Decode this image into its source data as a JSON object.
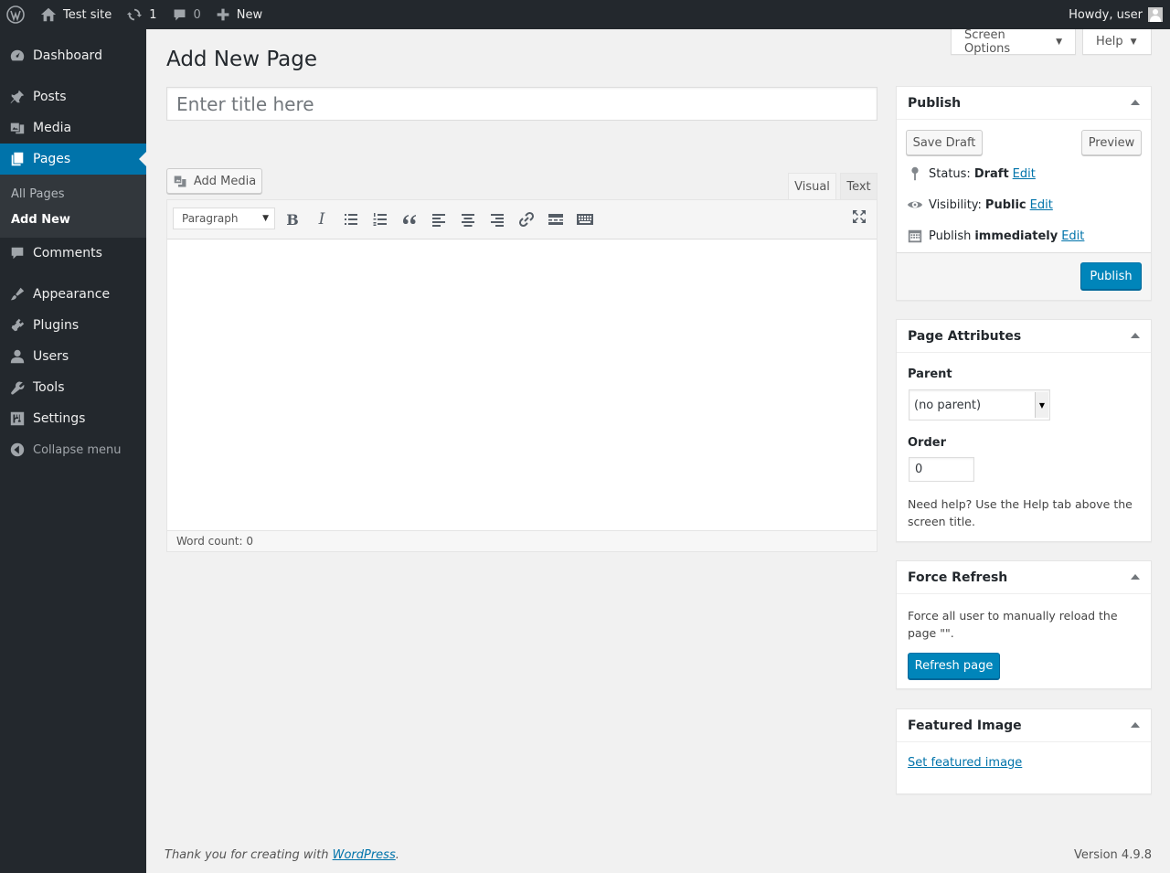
{
  "adminbar": {
    "site_name": "Test site",
    "updates_count": "1",
    "comments_count": "0",
    "new_label": "New",
    "howdy": "Howdy, user"
  },
  "sidebar": {
    "items": [
      {
        "label": "Dashboard",
        "icon": "dashboard-icon"
      },
      {
        "label": "Posts",
        "icon": "pin-icon"
      },
      {
        "label": "Media",
        "icon": "media-icon"
      },
      {
        "label": "Pages",
        "icon": "pages-icon"
      },
      {
        "label": "Comments",
        "icon": "comment-icon"
      },
      {
        "label": "Appearance",
        "icon": "brush-icon"
      },
      {
        "label": "Plugins",
        "icon": "plug-icon"
      },
      {
        "label": "Users",
        "icon": "user-icon"
      },
      {
        "label": "Tools",
        "icon": "wrench-icon"
      },
      {
        "label": "Settings",
        "icon": "settings-icon"
      }
    ],
    "submenu": [
      "All Pages",
      "Add New"
    ],
    "collapse_label": "Collapse menu"
  },
  "header": {
    "title": "Add New Page",
    "screen_options": "Screen Options",
    "help": "Help"
  },
  "editor": {
    "title_placeholder": "Enter title here",
    "add_media": "Add Media",
    "tab_visual": "Visual",
    "tab_text": "Text",
    "format_value": "Paragraph",
    "bold": "B",
    "italic": "I",
    "word_count": "Word count: 0"
  },
  "publish": {
    "title": "Publish",
    "save_draft": "Save Draft",
    "preview": "Preview",
    "status_label": "Status:",
    "status_value": "Draft",
    "visibility_label": "Visibility:",
    "visibility_value": "Public",
    "publish_label": "Publish",
    "publish_value": "immediately",
    "edit": "Edit",
    "publish_button": "Publish"
  },
  "page_attributes": {
    "title": "Page Attributes",
    "parent_label": "Parent",
    "parent_value": "(no parent)",
    "order_label": "Order",
    "order_value": "0",
    "help": "Need help? Use the Help tab above the screen title."
  },
  "force_refresh": {
    "title": "Force Refresh",
    "text": "Force all user to manually reload the page \"\".",
    "button": "Refresh page"
  },
  "featured_image": {
    "title": "Featured Image",
    "link": "Set featured image"
  },
  "footer": {
    "thanks": "Thank you for creating with",
    "wordpress_link": "WordPress",
    "version": "Version 4.9.8"
  }
}
